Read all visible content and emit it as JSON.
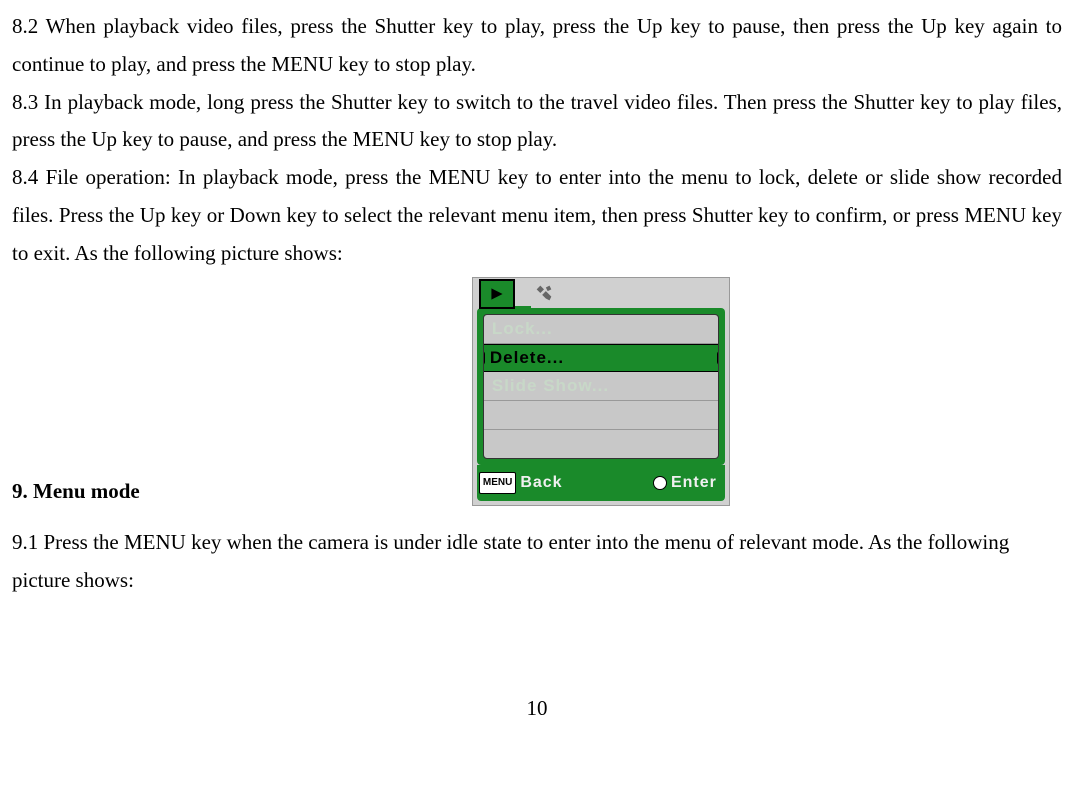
{
  "paragraphs": {
    "p82": "8.2 When playback video files, press the Shutter key to play, press the Up key to pause, then press the Up key again to continue to play, and press the MENU key to stop play.",
    "p83": "8.3 In playback mode, long press the Shutter key to switch to the travel video files. Then press the Shutter key to play files, press the Up key to pause, and press the MENU key to stop play.",
    "p84": "8.4 File operation: In playback mode, press the MENU key to enter into the menu to lock, delete or slide show recorded files. Press the Up key or Down key to select the relevant menu item, then press Shutter key to confirm, or press MENU key to exit. As the following picture shows:"
  },
  "menu": {
    "items": [
      "Lock...",
      "Delete...",
      "Slide Show...",
      "",
      ""
    ],
    "back_label_icon": "MENU",
    "back_label": "Back",
    "enter_label": "Enter"
  },
  "headings": {
    "h9": "9. Menu mode"
  },
  "p91": "9.1 Press the MENU key when the camera is under idle state to enter into the menu of relevant mode. As the following picture shows:",
  "page_number": "10"
}
